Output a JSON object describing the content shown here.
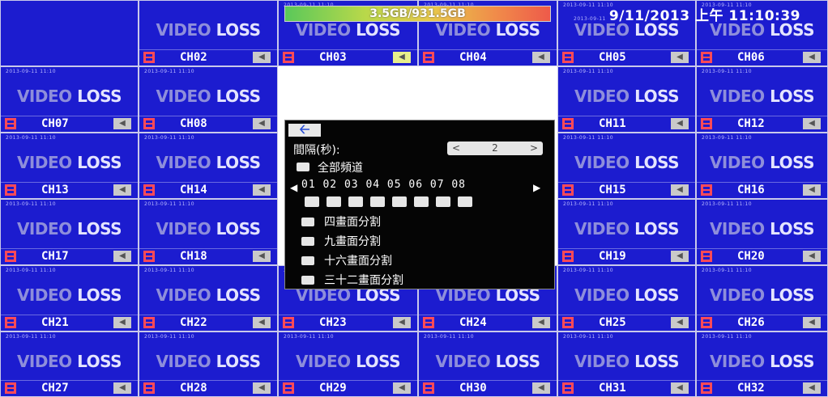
{
  "status": {
    "hdd_usage": "3.5GB/931.5GB",
    "datetime": "9/11/2013 上午 11:10:39",
    "datetime_prefix": "2013-09-11"
  },
  "cell_text": {
    "video": "VIDEO",
    "loss": "LOSS",
    "stamp": "2013-09-11 11:10"
  },
  "channels": [
    {
      "row": 0,
      "col": 0,
      "label": ""
    },
    {
      "row": 0,
      "col": 1,
      "label": "CH02"
    },
    {
      "row": 0,
      "col": 2,
      "label": "CH03",
      "active": true
    },
    {
      "row": 0,
      "col": 3,
      "label": "CH04"
    },
    {
      "row": 0,
      "col": 4,
      "label": "CH05"
    },
    {
      "row": 0,
      "col": 5,
      "label": "CH06"
    },
    {
      "row": 1,
      "col": 0,
      "label": "CH07"
    },
    {
      "row": 1,
      "col": 1,
      "label": "CH08"
    },
    {
      "row": 1,
      "col": 4,
      "label": "CH11"
    },
    {
      "row": 1,
      "col": 5,
      "label": "CH12"
    },
    {
      "row": 2,
      "col": 0,
      "label": "CH13"
    },
    {
      "row": 2,
      "col": 1,
      "label": "CH14"
    },
    {
      "row": 2,
      "col": 4,
      "label": "CH15"
    },
    {
      "row": 2,
      "col": 5,
      "label": "CH16"
    },
    {
      "row": 3,
      "col": 0,
      "label": "CH17"
    },
    {
      "row": 3,
      "col": 1,
      "label": "CH18"
    },
    {
      "row": 3,
      "col": 4,
      "label": "CH19"
    },
    {
      "row": 3,
      "col": 5,
      "label": "CH20"
    },
    {
      "row": 4,
      "col": 0,
      "label": "CH21"
    },
    {
      "row": 4,
      "col": 1,
      "label": "CH22"
    },
    {
      "row": 4,
      "col": 2,
      "label": "CH23"
    },
    {
      "row": 4,
      "col": 3,
      "label": "CH24"
    },
    {
      "row": 4,
      "col": 4,
      "label": "CH25"
    },
    {
      "row": 4,
      "col": 5,
      "label": "CH26"
    },
    {
      "row": 5,
      "col": 0,
      "label": "CH27"
    },
    {
      "row": 5,
      "col": 1,
      "label": "CH28"
    },
    {
      "row": 5,
      "col": 2,
      "label": "CH29"
    },
    {
      "row": 5,
      "col": 3,
      "label": "CH30"
    },
    {
      "row": 5,
      "col": 4,
      "label": "CH31"
    },
    {
      "row": 5,
      "col": 5,
      "label": "CH32"
    }
  ],
  "menu": {
    "back_icon": "back-arrow-icon",
    "interval_label": "間隔(秒):",
    "interval_value": "2",
    "all_channels": "全部頻道",
    "channel_numbers": "01 02 03 04 05 06 07 08",
    "split_4": "四畫面分割",
    "split_9": "九畫面分割",
    "split_16": "十六畫面分割",
    "split_32": "三十二畫面分割"
  },
  "colors": {
    "cell_bg": "#1c1ccf",
    "rec_icon": "#ff4a57",
    "menu_bg": "#050505"
  }
}
